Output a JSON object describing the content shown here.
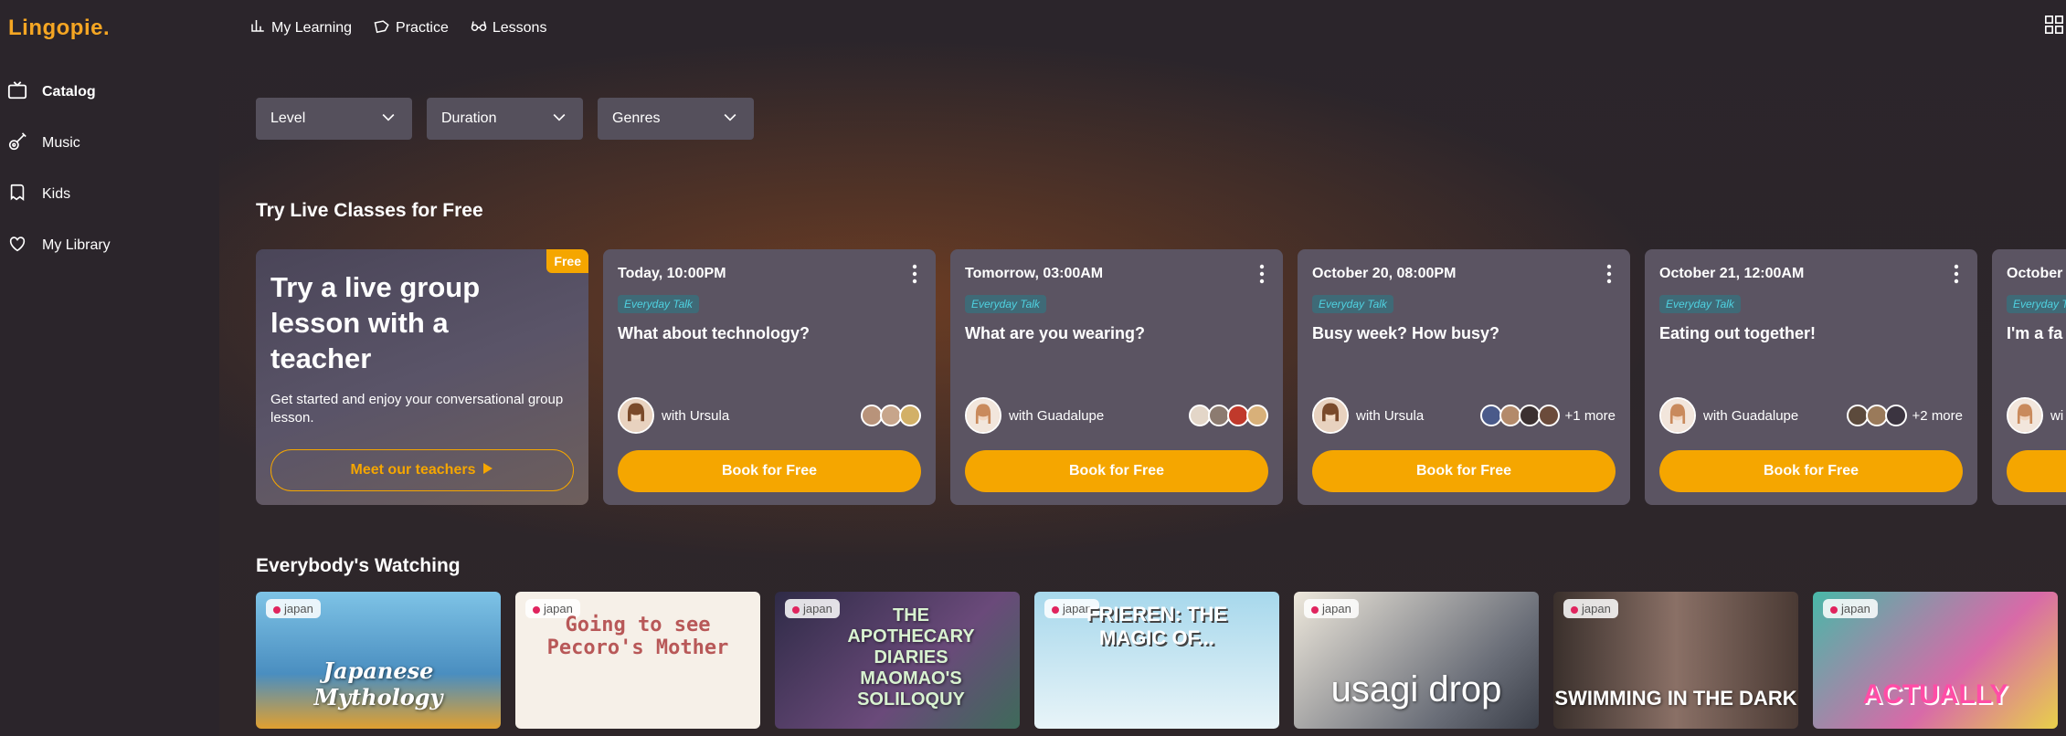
{
  "app": {
    "logo": "Lingopie."
  },
  "sidebar": {
    "items": [
      {
        "label": "Catalog",
        "icon": "tv-icon",
        "active": true
      },
      {
        "label": "Music",
        "icon": "guitar-icon"
      },
      {
        "label": "Kids",
        "icon": "kids-icon"
      },
      {
        "label": "My Library",
        "icon": "heart-icon"
      }
    ]
  },
  "topnav": [
    {
      "label": "My Learning",
      "icon": "chart-icon"
    },
    {
      "label": "Practice",
      "icon": "tag-icon"
    },
    {
      "label": "Lessons",
      "icon": "glasses-icon"
    }
  ],
  "filters": [
    "Level",
    "Duration",
    "Genres"
  ],
  "live": {
    "title": "Try Live Classes for Free",
    "promo": {
      "badge": "Free",
      "heading": "Try a live group lesson with a teacher",
      "text": "Get started and enjoy your conversational group lesson.",
      "button": "Meet our teachers"
    },
    "classes": [
      {
        "time": "Today, 10:00PM",
        "tag": "Everyday Talk",
        "topic": "What about technology?",
        "teacher": "with Ursula",
        "students": 3,
        "more": "",
        "book": "Book for Free"
      },
      {
        "time": "Tomorrow, 03:00AM",
        "tag": "Everyday Talk",
        "topic": "What are you wearing?",
        "teacher": "with Guadalupe",
        "students": 4,
        "more": "",
        "book": "Book for Free"
      },
      {
        "time": "October 20, 08:00PM",
        "tag": "Everyday Talk",
        "topic": "Busy week? How busy?",
        "teacher": "with Ursula",
        "students": 4,
        "more": "+1 more",
        "book": "Book for Free"
      },
      {
        "time": "October 21, 12:00AM",
        "tag": "Everyday Talk",
        "topic": "Eating out together!",
        "teacher": "with Guadalupe",
        "students": 3,
        "more": "+2 more",
        "book": "Book for Free"
      },
      {
        "time": "October",
        "tag": "Everyday Talk",
        "topic": "I'm a fa",
        "teacher": "wi",
        "students": 0,
        "more": "",
        "book": ""
      }
    ]
  },
  "watching": {
    "title": "Everybody's Watching",
    "tiles": [
      {
        "lang": "japan",
        "title": "Japanese Mythology",
        "bg": "#6fb6d8"
      },
      {
        "lang": "japan",
        "title": "Going to see Pecoro's Mother",
        "bg": "#f6f0e8"
      },
      {
        "lang": "japan",
        "title": "THE APOTHECARY DIARIES MAOMAO'S SOLILOQUY",
        "bg": "#3e3a55"
      },
      {
        "lang": "japan",
        "title": "FRIEREN: THE MAGIC OF...",
        "bg": "#a9d6e8"
      },
      {
        "lang": "japan",
        "title": "usagi drop",
        "bg": "#d9d6cf"
      },
      {
        "lang": "japan",
        "title": "SWIMMING IN THE DARK",
        "bg": "#6b5a55"
      },
      {
        "lang": "japan",
        "title": "ACTUALLY",
        "bg": "#4bb2a8"
      }
    ]
  }
}
